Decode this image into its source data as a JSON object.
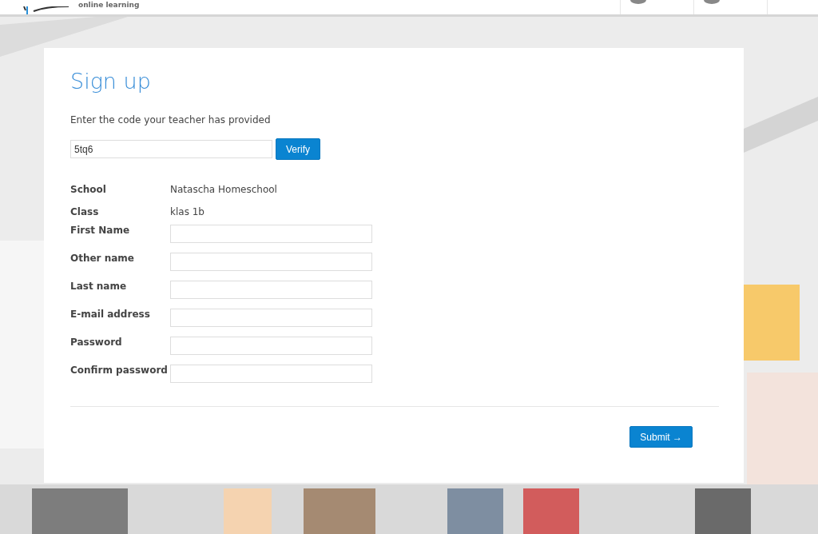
{
  "header": {
    "logo_tagline": "online learning"
  },
  "form": {
    "title": "Sign up",
    "code_prompt": "Enter the code your teacher has provided",
    "code_value": "5tq6",
    "verify_button": "Verify",
    "info": [
      {
        "label": "School",
        "value": "Natascha Homeschool"
      },
      {
        "label": "Class",
        "value": "klas 1b"
      }
    ],
    "fields": [
      {
        "label": "First Name"
      },
      {
        "label": "Other name"
      },
      {
        "label": "Last name"
      },
      {
        "label": "E-mail address"
      },
      {
        "label": "Password"
      },
      {
        "label": "Confirm password"
      }
    ],
    "submit_button": "Submit →"
  }
}
